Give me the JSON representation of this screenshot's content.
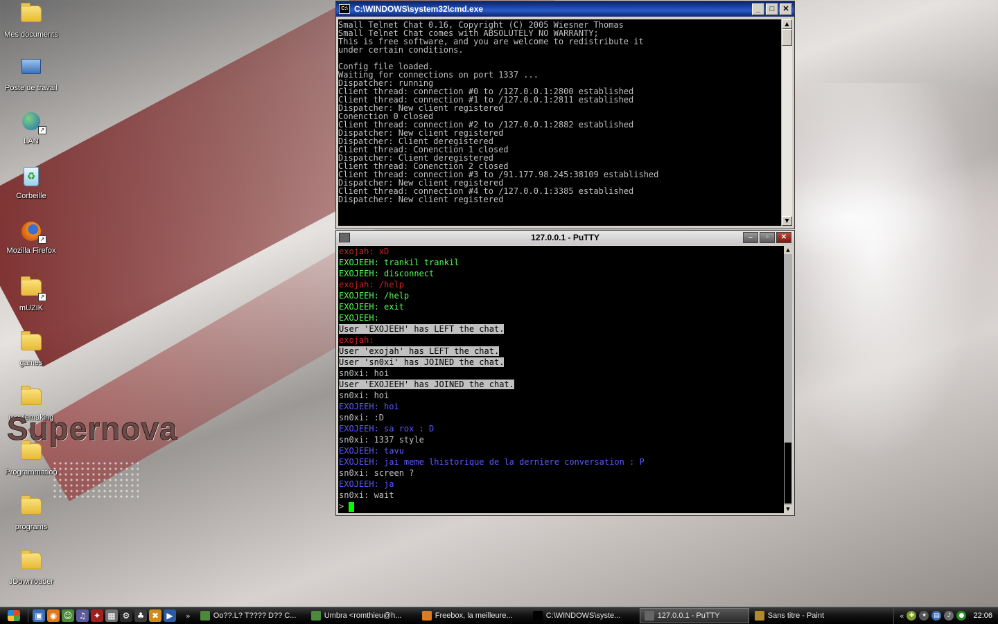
{
  "desktop": {
    "icons": [
      {
        "label": "Mes documents",
        "icon": "my-documents-icon"
      },
      {
        "label": "Poste de travail",
        "icon": "my-computer-icon"
      },
      {
        "label": "LAN",
        "icon": "network-globe-icon"
      },
      {
        "label": "Corbeille",
        "icon": "recycle-bin-icon"
      },
      {
        "label": "Mozilla Firefox",
        "icon": "firefox-icon"
      },
      {
        "label": "mUZIK",
        "icon": "music-folder-icon"
      },
      {
        "label": "games",
        "icon": "folder-icon"
      },
      {
        "label": "moviemaking",
        "icon": "folder-icon"
      },
      {
        "label": "Programmation",
        "icon": "folder-icon"
      },
      {
        "label": "programs",
        "icon": "folder-icon"
      },
      {
        "label": "JDownloader",
        "icon": "folder-icon"
      }
    ],
    "brand_text": "Supernova"
  },
  "cmd_window": {
    "title": "C:\\WINDOWS\\system32\\cmd.exe",
    "lines": [
      "Small Telnet Chat 0.16, Copyright (C) 2005 Wiesner Thomas",
      "Small Telnet Chat comes with ABSOLUTELY NO WARRANTY;",
      "This is free software, and you are welcome to redistribute it",
      "under certain conditions.",
      "",
      "Config file loaded.",
      "Waiting for connections on port 1337 ...",
      "Dispatcher: running",
      "Client thread: connection #0 to /127.0.0.1:2800 established",
      "Client thread: connection #1 to /127.0.0.1:2811 established",
      "Dispatcher: New client registered",
      "Conenction 0 closed",
      "Client thread: connection #2 to /127.0.0.1:2882 established",
      "Dispatcher: New client registered",
      "Dispatcher: Client deregistered",
      "Client thread: Conenction 1 closed",
      "Dispatcher: Client deregistered",
      "Client thread: Conenction 2 closed",
      "Client thread: connection #3 to /91.177.98.245:38109 established",
      "Dispatcher: New client registered",
      "Client thread: connection #4 to /127.0.0.1:3385 established",
      "Dispatcher: New client registered"
    ]
  },
  "putty_window": {
    "title": "127.0.0.1 - PuTTY",
    "lines": [
      {
        "text": "exojah: xD",
        "style": "red"
      },
      {
        "text": "EXOJEEH: trankil trankil",
        "style": "green"
      },
      {
        "text": "EXOJEEH: disconnect",
        "style": "green"
      },
      {
        "text": "exojah: /help",
        "style": "red"
      },
      {
        "text": "EXOJEEH: /help",
        "style": "green"
      },
      {
        "text": "EXOJEEH: exit",
        "style": "green"
      },
      {
        "text": "EXOJEEH:",
        "style": "green"
      },
      {
        "text": "User 'EXOJEEH' has LEFT the chat.",
        "style": "sys"
      },
      {
        "text": "exojah:",
        "style": "red"
      },
      {
        "text": "User 'exojah' has LEFT the chat.",
        "style": "sys"
      },
      {
        "text": "User 'sn0xi' has JOINED the chat.",
        "style": "sys"
      },
      {
        "text": "sn0xi: hoi",
        "style": "grey"
      },
      {
        "text": "User 'EXOJEEH' has JOINED the chat.",
        "style": "sys"
      },
      {
        "text": "sn0xi: hoi",
        "style": "grey"
      },
      {
        "text": "EXOJEEH: hoi",
        "style": "blue"
      },
      {
        "text": "sn0xi: :D",
        "style": "grey"
      },
      {
        "text": "EXOJEEH: sa rox : D",
        "style": "blue"
      },
      {
        "text": "sn0xi: 1337 style",
        "style": "grey"
      },
      {
        "text": "EXOJEEH: tavu",
        "style": "blue"
      },
      {
        "text": "EXOJEEH: jai meme lhistorique de la derniere conversation : P",
        "style": "blue"
      },
      {
        "text": "sn0xi: screen ?",
        "style": "grey"
      },
      {
        "text": "EXOJEEH: ja",
        "style": "blue"
      },
      {
        "text": "sn0xi: wait",
        "style": "grey"
      }
    ],
    "prompt": "> "
  },
  "taskbar": {
    "tasks": [
      {
        "label": "Oo??.L? T???? D?? C...",
        "icon": "messenger-icon",
        "active": false
      },
      {
        "label": "Umbra <romthieu@h...",
        "icon": "messenger-icon",
        "active": false
      },
      {
        "label": "Freebox, la meilleure...",
        "icon": "firefox-icon",
        "active": false
      },
      {
        "label": "C:\\WINDOWS\\syste...",
        "icon": "cmd-icon",
        "active": false
      },
      {
        "label": "127.0.0.1 - PuTTY",
        "icon": "putty-icon",
        "active": true
      },
      {
        "label": "Sans titre - Paint",
        "icon": "paint-icon",
        "active": false
      }
    ],
    "clock": "22:06"
  },
  "colors": {
    "console_bg": "#000000",
    "chat_red": "#cc2222",
    "chat_green": "#55ff55",
    "chat_blue": "#5a5aff",
    "cmd_titlebar": "#0a246a"
  }
}
